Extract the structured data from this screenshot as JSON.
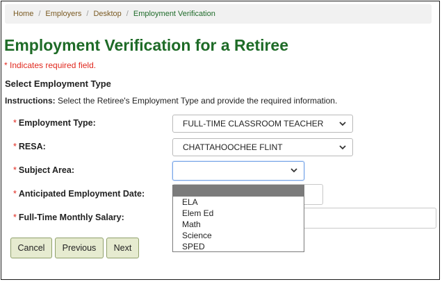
{
  "breadcrumb": {
    "items": [
      "Home",
      "Employers",
      "Desktop"
    ],
    "current": "Employment Verification",
    "separator": "/"
  },
  "page": {
    "title": "Employment Verification for a Retiree",
    "required_note": "* Indicates required field.",
    "section_heading": "Select Employment Type",
    "instructions_label": "Instructions:",
    "instructions_text": " Select the Retiree's Employment Type and provide the required information."
  },
  "form": {
    "employment_type": {
      "label": "Employment Type:",
      "value": "FULL-TIME CLASSROOM TEACHER"
    },
    "resa": {
      "label": "RESA:",
      "value": "CHATTAHOOCHEE FLINT"
    },
    "subject_area": {
      "label": "Subject Area:",
      "value": "",
      "options": [
        "",
        "ELA",
        "Elem Ed",
        "Math",
        "Science",
        "SPED"
      ]
    },
    "anticipated_date": {
      "label": "Anticipated Employment Date:"
    },
    "salary": {
      "label": "Full-Time Monthly Salary:"
    },
    "required_marker": "*"
  },
  "buttons": {
    "cancel": "Cancel",
    "previous": "Previous",
    "next": "Next"
  },
  "colors": {
    "title": "#1e6b27",
    "required": "#e0281e",
    "button_bg": "#e6ebd0",
    "breadcrumb_link": "#7a5a22"
  },
  "icons": {
    "select_arrow": "chevron-down-icon"
  }
}
